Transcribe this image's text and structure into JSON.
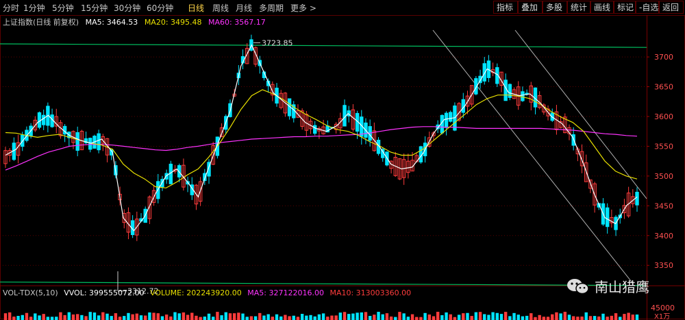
{
  "toolbar": {
    "tabs": [
      "分时",
      "1分钟",
      "5分钟",
      "15分钟",
      "30分钟",
      "60分钟",
      "日线",
      "周线",
      "月线",
      "多周期",
      "更多 >"
    ],
    "active_tab": "日线",
    "right_buttons": [
      "指标",
      "叠加",
      "多股",
      "统计",
      "画线",
      "标记",
      "-自选",
      "返回"
    ]
  },
  "legend": {
    "title": "上证指数(日线 前复权)",
    "ma5": "MA5: 3464.53",
    "ma20": "MA20: 3495.48",
    "ma60": "MA60: 3567.17"
  },
  "annotations": {
    "high": "3723.85",
    "low": "3312.72"
  },
  "volume_legend": {
    "title": "VOL-TDX(5,10)",
    "vvol": "VVOL: 399555072.00",
    "volume": "VOLUME: 202243920.00",
    "ma5": "MA5: 327122016.00",
    "ma10": "MA10: 313003360.00"
  },
  "watermark": "南山猎鹰",
  "colors": {
    "up": "#ff3c3c",
    "down": "#00e5ff",
    "ma5": "#ffffff",
    "ma20": "#e8e000",
    "ma60": "#ff33ff",
    "channel": "#00c060",
    "trendline": "#b0b0b0"
  },
  "chart_data": {
    "type": "candlestick",
    "ylim": [
      3310,
      3745
    ],
    "y_ticks": [
      "3700",
      "3650",
      "3600",
      "3550",
      "3500",
      "3450",
      "3400",
      "3350"
    ],
    "volume_tick": "45000",
    "volume_unit": "X1万",
    "ma_lines": {
      "ma5": [
        3535,
        3545,
        3568,
        3590,
        3602,
        3583,
        3568,
        3560,
        3555,
        3562,
        3540,
        3430,
        3408,
        3432,
        3470,
        3500,
        3512,
        3490,
        3465,
        3515,
        3562,
        3610,
        3685,
        3720,
        3680,
        3640,
        3625,
        3610,
        3590,
        3580,
        3575,
        3585,
        3605,
        3590,
        3570,
        3548,
        3520,
        3512,
        3515,
        3538,
        3572,
        3595,
        3598,
        3620,
        3650,
        3680,
        3670,
        3640,
        3635,
        3638,
        3622,
        3600,
        3588,
        3565,
        3520,
        3470,
        3430,
        3420,
        3450,
        3465
      ],
      "ma20": [
        3573,
        3572,
        3568,
        3565,
        3568,
        3570,
        3565,
        3560,
        3555,
        3552,
        3545,
        3520,
        3505,
        3495,
        3482,
        3480,
        3490,
        3502,
        3512,
        3532,
        3555,
        3582,
        3612,
        3635,
        3645,
        3638,
        3628,
        3615,
        3604,
        3595,
        3585,
        3578,
        3575,
        3568,
        3558,
        3550,
        3540,
        3535,
        3535,
        3545,
        3560,
        3575,
        3590,
        3605,
        3620,
        3630,
        3636,
        3636,
        3634,
        3630,
        3620,
        3608,
        3598,
        3590,
        3575,
        3550,
        3525,
        3508,
        3500,
        3495
      ],
      "ma60": [
        3510,
        3517,
        3525,
        3533,
        3540,
        3545,
        3550,
        3552,
        3553,
        3553,
        3552,
        3550,
        3548,
        3546,
        3544,
        3543,
        3545,
        3548,
        3550,
        3553,
        3556,
        3558,
        3560,
        3562,
        3563,
        3564,
        3565,
        3566,
        3566,
        3567,
        3567,
        3568,
        3569,
        3570,
        3572,
        3575,
        3578,
        3580,
        3582,
        3583,
        3583,
        3582,
        3582,
        3581,
        3580,
        3580,
        3580,
        3580,
        3580,
        3580,
        3580,
        3579,
        3578,
        3577,
        3575,
        3573,
        3571,
        3570,
        3568,
        3567
      ]
    }
  }
}
